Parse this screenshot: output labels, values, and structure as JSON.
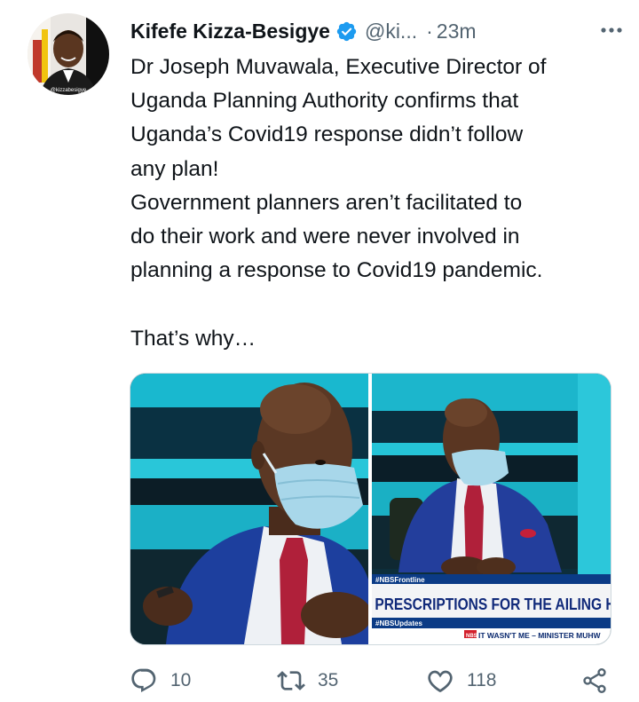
{
  "tweet": {
    "author_name": "Kifefe Kizza-Besigye",
    "handle": "@ki...",
    "separator": "·",
    "time": "23m",
    "text_lines": [
      "Dr Joseph Muvawala, Executive Director of",
      "Uganda Planning Authority confirms that",
      "Uganda’s Covid19 response didn’t follow",
      "any plan!",
      "Government planners aren’t facilitated to",
      "do their work and were never involved in",
      "planning a response to Covid19 pandemic.",
      "",
      "That’s why…"
    ],
    "avatar_caption": "@kizzabesigye",
    "media": {
      "banner_tag": "#NBSFrontline",
      "headline": "PRESCRIPTIONS FOR THE AILING HEALTH S",
      "sub_tag": "#NBSUpdates",
      "channel_badge": "NBS",
      "ticker": "IT WASN'T ME – MINISTER MUHW"
    },
    "actions": {
      "replies": "10",
      "retweets": "35",
      "likes": "118"
    },
    "colors": {
      "verified": "#1d9bf0",
      "secondary_text": "#536471",
      "studio_cyan": "#19b8cf"
    }
  }
}
